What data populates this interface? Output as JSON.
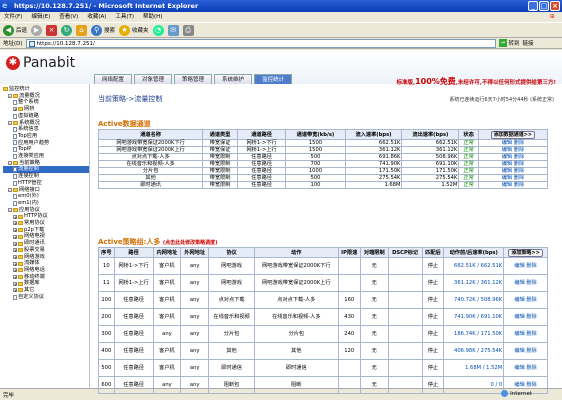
{
  "window": {
    "title": "https://10.128.7.251/ - Microsoft Internet Explorer"
  },
  "menu": [
    "文件(F)",
    "编辑(E)",
    "查看(V)",
    "收藏(A)",
    "工具(T)",
    "帮助(H)"
  ],
  "toolbar": {
    "back": "后退",
    "search": "搜索",
    "favorites": "收藏夹"
  },
  "address": {
    "label": "地址(D)",
    "url": "https://10.128.7.251/",
    "go": "转到",
    "links": "链接"
  },
  "app": {
    "brand": "Panabit",
    "tabs": [
      "网络配置",
      "对象管理",
      "策略管理",
      "系统维护",
      "监控统计"
    ],
    "active_tab": 4,
    "promo_prefix": "标准版,",
    "promo_big": "100%免费",
    "promo_suffix": ",未经许可,不得以任何形式提供给第三方!"
  },
  "sidebar": {
    "items": [
      {
        "label": "监控统计",
        "type": "folder",
        "indent": 0
      },
      {
        "label": "流量概况",
        "type": "folder",
        "indent": 1,
        "pm": "-"
      },
      {
        "label": "整个系统",
        "type": "page",
        "indent": 2
      },
      {
        "label": "网桥",
        "type": "folder",
        "indent": 2,
        "pm": "+"
      },
      {
        "label": "虚拟链路",
        "type": "page",
        "indent": 2
      },
      {
        "label": "系统概况",
        "type": "folder",
        "indent": 1,
        "pm": "-"
      },
      {
        "label": "系统信息",
        "type": "page",
        "indent": 2
      },
      {
        "label": "Top应用",
        "type": "page",
        "indent": 2
      },
      {
        "label": "应用用户趋势",
        "type": "page",
        "indent": 2
      },
      {
        "label": "TopIP",
        "type": "page",
        "indent": 2
      },
      {
        "label": "连接类应用",
        "type": "page",
        "indent": 2
      },
      {
        "label": "当前策略",
        "type": "folder",
        "indent": 1,
        "pm": "-"
      },
      {
        "label": "流量控制",
        "type": "page",
        "indent": 2,
        "selected": true
      },
      {
        "label": "连接控制",
        "type": "page",
        "indent": 2
      },
      {
        "label": "HTTP管控",
        "type": "page",
        "indent": 2
      },
      {
        "label": "网络接口",
        "type": "folder",
        "indent": 1,
        "pm": "-"
      },
      {
        "label": "em0(外)",
        "type": "page",
        "indent": 2
      },
      {
        "label": "em1(内)",
        "type": "page",
        "indent": 2
      },
      {
        "label": "应用协议",
        "type": "folder",
        "indent": 1,
        "pm": "-"
      },
      {
        "label": "HTTP协议",
        "type": "folder",
        "indent": 2,
        "pm": "+"
      },
      {
        "label": "常用协议",
        "type": "folder",
        "indent": 2,
        "pm": "+"
      },
      {
        "label": "p2p下载",
        "type": "folder",
        "indent": 2,
        "pm": "+"
      },
      {
        "label": "网络电视",
        "type": "folder",
        "indent": 2,
        "pm": "+"
      },
      {
        "label": "即时通讯",
        "type": "folder",
        "indent": 2,
        "pm": "+"
      },
      {
        "label": "股票交易",
        "type": "folder",
        "indent": 2,
        "pm": "+"
      },
      {
        "label": "网络游戏",
        "type": "folder",
        "indent": 2,
        "pm": "+"
      },
      {
        "label": "流媒体",
        "type": "folder",
        "indent": 2,
        "pm": "+"
      },
      {
        "label": "网络电话",
        "type": "folder",
        "indent": 2,
        "pm": "+"
      },
      {
        "label": "移动终端",
        "type": "folder",
        "indent": 2,
        "pm": "+"
      },
      {
        "label": "数据库",
        "type": "folder",
        "indent": 2,
        "pm": "+"
      },
      {
        "label": "其它",
        "type": "folder",
        "indent": 2,
        "pm": "+"
      },
      {
        "label": "自定义协议",
        "type": "page",
        "indent": 2
      }
    ]
  },
  "content": {
    "crumb": "当前策略->流量控制",
    "uptime": "系统已连续运行6天7小时54分44秒 (系统正常)",
    "channels_title": "Active数据通道",
    "channels_add": "添加数据通道>>",
    "channels_headers": [
      "通道名称",
      "通道类型",
      "通道路径",
      "通道带宽(kb/s)",
      "流入速率(bps)",
      "流出速率(bps)",
      "状态",
      "操作"
    ],
    "channels": [
      {
        "name": "网吧游戏带宽保证2000K下行",
        "type": "带宽保证",
        "path": "网桥1->下行",
        "bw": "1500",
        "in": "662.51K",
        "out": "662.51K",
        "state": "正常"
      },
      {
        "name": "网吧游戏带宽保证2000K上行",
        "type": "带宽保证",
        "path": "网桥1->上行",
        "bw": "1500",
        "in": "361.12K",
        "out": "361.12K",
        "state": "正常"
      },
      {
        "name": "点对点下载-人多",
        "type": "带宽限制",
        "path": "任意路径",
        "bw": "500",
        "in": "691.86K",
        "out": "508.96K",
        "state": "正常"
      },
      {
        "name": "在线音乐和视频-人多",
        "type": "带宽限制",
        "path": "任意路径",
        "bw": "700",
        "in": "741.90K",
        "out": "691.10K",
        "state": "正常"
      },
      {
        "name": "分片包",
        "type": "带宽限制",
        "path": "任意路径",
        "bw": "1000",
        "in": "171.50K",
        "out": "171.50K",
        "state": "正常"
      },
      {
        "name": "其他",
        "type": "带宽限制",
        "path": "任意路径",
        "bw": "500",
        "in": "275.54K",
        "out": "275.54K",
        "state": "正常"
      },
      {
        "name": "即时通讯",
        "type": "带宽限制",
        "path": "任意路径",
        "bw": "100",
        "in": "1.68M",
        "out": "1.52M",
        "state": "正常"
      }
    ],
    "edit": "编辑",
    "delete": "删除",
    "policy_title": "Active策略组:人多",
    "policy_hint": "(点击此处修改策略调度)",
    "policy_add": "添加策略>>",
    "policy_headers": [
      "序号",
      "路径",
      "内网地址",
      "外网地址",
      "协议",
      "动作",
      "IP限速",
      "对端限制",
      "DSCP标记",
      "匹配后",
      "动作前/后速率(bps)",
      "操作"
    ],
    "policies": [
      {
        "no": "10",
        "path": "网桥1->下行",
        "inner": "客户机",
        "outer": "any",
        "proto": "网吧游戏",
        "action": "网吧游戏带宽保证2000K下行",
        "iplimit": "",
        "peer": "无",
        "dscp": "",
        "after": "停止",
        "rate": "662.51K / 662.51K"
      },
      {
        "no": "11",
        "path": "网桥1->上行",
        "inner": "客户机",
        "outer": "any",
        "proto": "网吧游戏",
        "action": "网吧游戏带宽保证2000K上行",
        "iplimit": "",
        "peer": "无",
        "dscp": "",
        "after": "停止",
        "rate": "361.12K / 361.12K"
      },
      {
        "no": "100",
        "path": "任意路径",
        "inner": "客户机",
        "outer": "any",
        "proto": "点对点下载",
        "action": "点对点下载-人多",
        "iplimit": "160",
        "peer": "无",
        "dscp": "",
        "after": "停止",
        "rate": "740.72K / 508.96K"
      },
      {
        "no": "200",
        "path": "任意路径",
        "inner": "客户机",
        "outer": "any",
        "proto": "在线音乐和视频",
        "action": "在线音乐和视频-人多",
        "iplimit": "430",
        "peer": "无",
        "dscp": "",
        "after": "停止",
        "rate": "741.90K / 691.10K"
      },
      {
        "no": "300",
        "path": "任意路径",
        "inner": "any",
        "outer": "any",
        "proto": "分片包",
        "action": "分片包",
        "iplimit": "240",
        "peer": "无",
        "dscp": "",
        "after": "停止",
        "rate": "186.74K / 171.50K"
      },
      {
        "no": "400",
        "path": "任意路径",
        "inner": "客户机",
        "outer": "any",
        "proto": "其他",
        "action": "其他",
        "iplimit": "120",
        "peer": "无",
        "dscp": "",
        "after": "停止",
        "rate": "406.98K / 275.54K"
      },
      {
        "no": "500",
        "path": "任意路径",
        "inner": "客户机",
        "outer": "any",
        "proto": "即时通信",
        "action": "即时通信",
        "iplimit": "",
        "peer": "无",
        "dscp": "",
        "after": "停止",
        "rate": "1.68M / 1.52M"
      },
      {
        "no": "600",
        "path": "任意路径",
        "inner": "any",
        "outer": "any",
        "proto": "阻断包",
        "action": "阻断",
        "iplimit": "",
        "peer": "无",
        "dscp": "",
        "after": "停止",
        "rate": "0 / 0"
      }
    ]
  },
  "status": {
    "left": "完毕",
    "zone": "Internet"
  }
}
